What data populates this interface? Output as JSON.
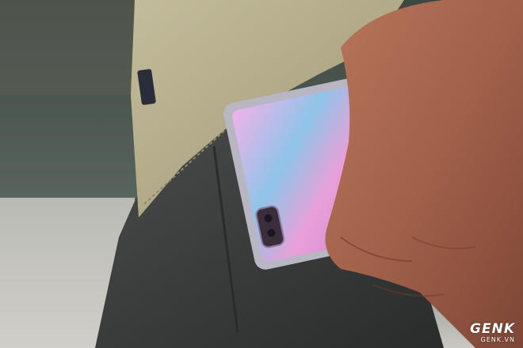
{
  "scene": {
    "subject": "hand-sliding-flip-phone-into-pocket",
    "colors": {
      "background": "#2f3a36",
      "shirt": "#b7b08f",
      "trousers": "#3b3d3c",
      "phone_screen": "#e6a6e0",
      "skin": "#a5654e"
    }
  },
  "watermark": {
    "brand": "GENK",
    "domain": "GENK.VN"
  }
}
